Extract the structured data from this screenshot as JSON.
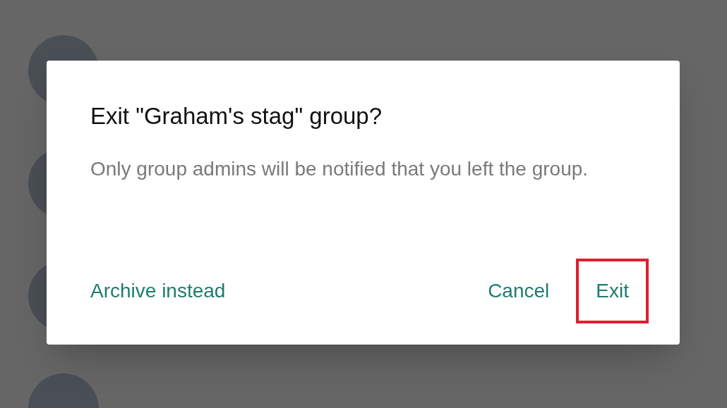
{
  "dialog": {
    "title": "Exit \"Graham's stag\" group?",
    "message": "Only group admins will be notified that you left the group.",
    "buttons": [
      {
        "label": "Archive instead",
        "highlighted": false
      },
      {
        "label": "Cancel",
        "highlighted": false
      },
      {
        "label": "Exit",
        "highlighted": true
      }
    ]
  }
}
